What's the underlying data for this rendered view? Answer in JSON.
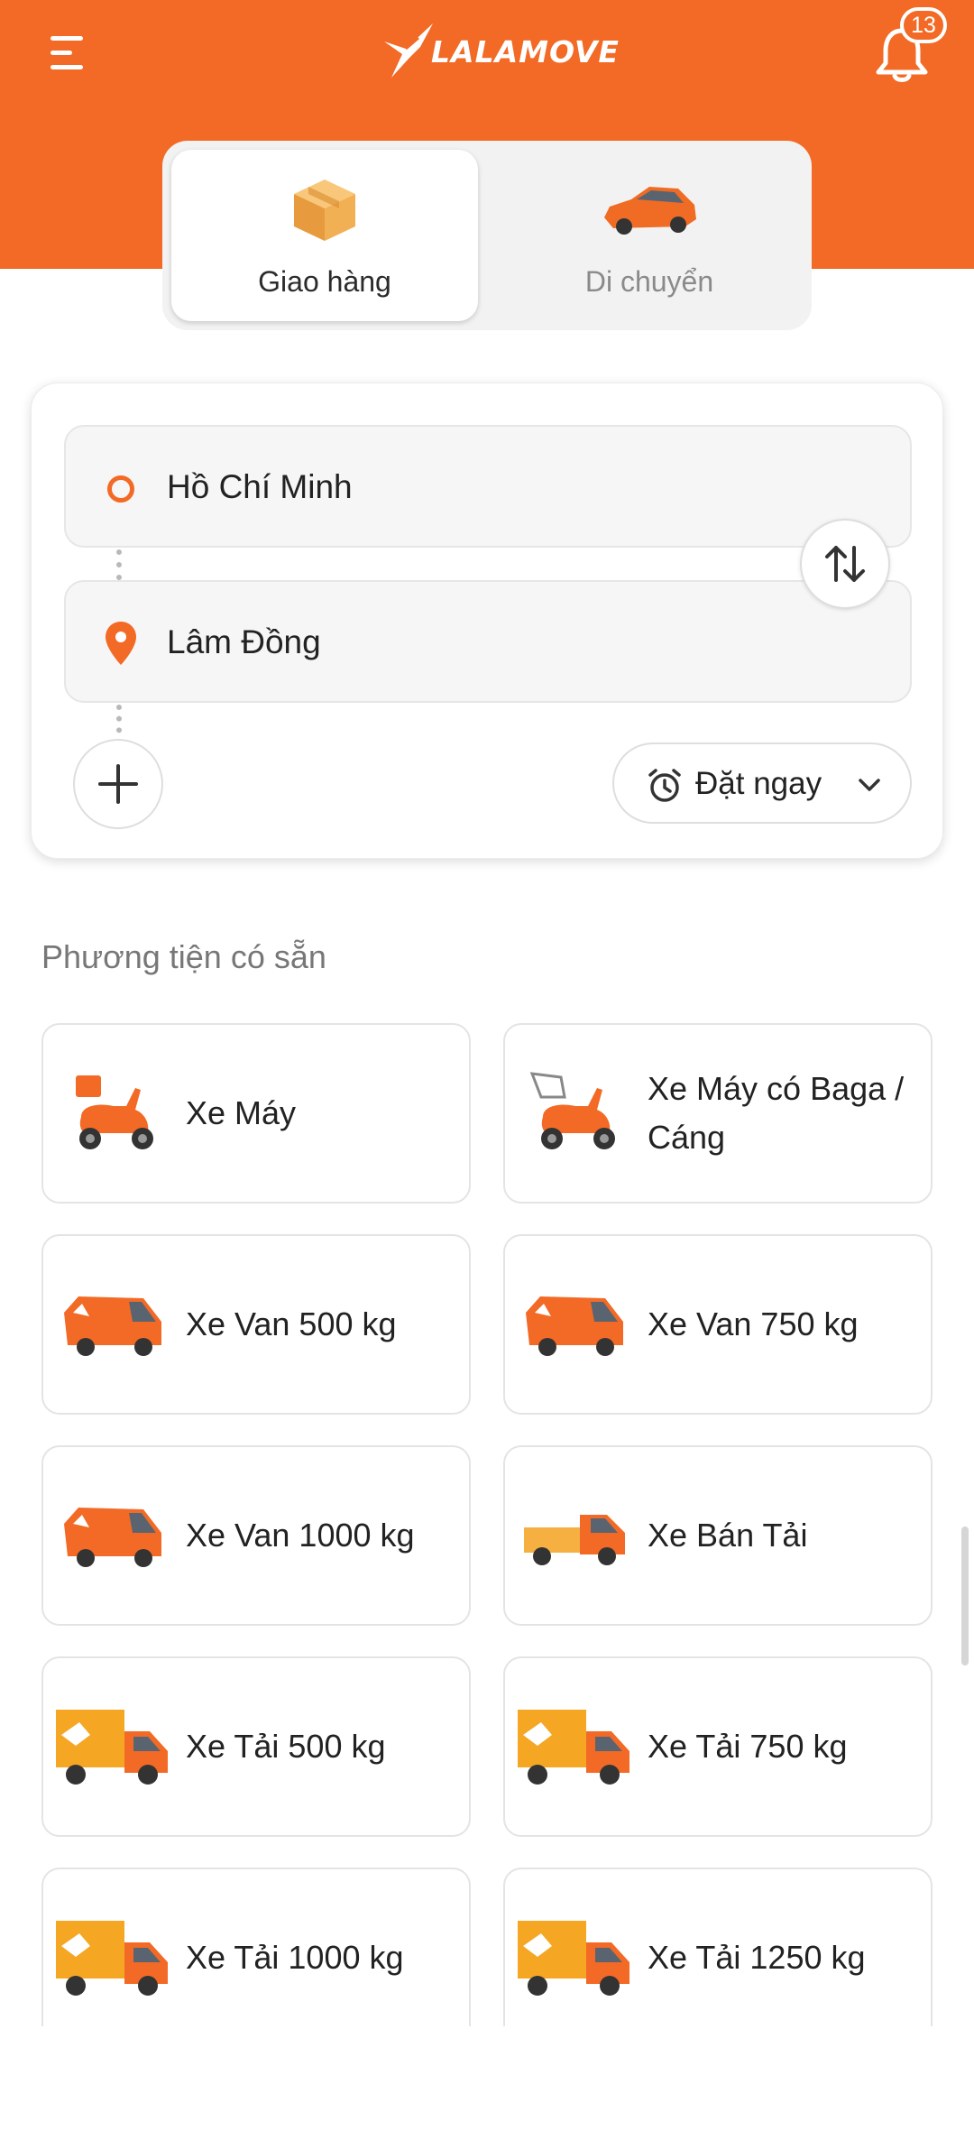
{
  "header": {
    "logo_text": "LALAMOVE",
    "notification_count": "13",
    "colors": {
      "brand_orange": "#f26a25",
      "text_dark": "#222222",
      "text_muted": "#8a8a8a"
    }
  },
  "mode_tabs": [
    {
      "label": "Giao hàng",
      "icon": "box-icon",
      "selected": true
    },
    {
      "label": "Di chuyển",
      "icon": "car-icon",
      "selected": false
    }
  ],
  "route": {
    "pickup": "Hồ Chí Minh",
    "dropoff": "Lâm Đồng",
    "schedule_label": "Đặt ngay"
  },
  "vehicles_section": {
    "title": "Phương tiện có sẵn",
    "items": [
      {
        "name": "Xe Máy",
        "icon": "motorbike-icon"
      },
      {
        "name": "Xe Máy có Baga / Cáng",
        "icon": "motorbike-rack-icon"
      },
      {
        "name": "Xe Van 500 kg",
        "icon": "van-icon"
      },
      {
        "name": "Xe Van 750 kg",
        "icon": "van-icon"
      },
      {
        "name": "Xe Van 1000 kg",
        "icon": "van-icon"
      },
      {
        "name": "Xe Bán Tải",
        "icon": "pickup-truck-icon"
      },
      {
        "name": "Xe Tải 500 kg",
        "icon": "truck-icon"
      },
      {
        "name": "Xe Tải 750 kg",
        "icon": "truck-icon"
      },
      {
        "name": "Xe Tải 1000 kg",
        "icon": "truck-icon"
      },
      {
        "name": "Xe Tải 1250 kg",
        "icon": "truck-icon"
      }
    ]
  }
}
